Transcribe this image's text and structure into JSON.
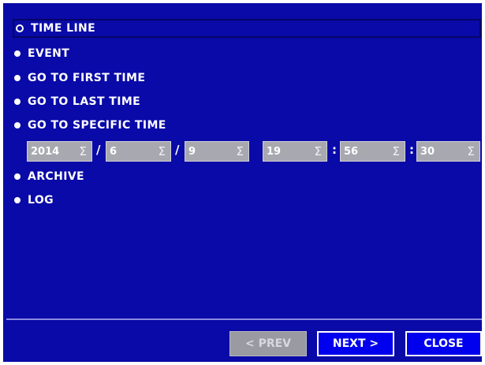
{
  "menu": {
    "items": [
      {
        "label": "TIME LINE",
        "selected": true
      },
      {
        "label": "EVENT"
      },
      {
        "label": "GO TO FIRST TIME"
      },
      {
        "label": "GO TO LAST TIME"
      },
      {
        "label": "GO TO SPECIFIC TIME"
      },
      {
        "label": "ARCHIVE"
      },
      {
        "label": "LOG"
      }
    ]
  },
  "specific_time": {
    "year": "2014",
    "month": "6",
    "day": "9",
    "hour": "19",
    "minute": "56",
    "second": "30",
    "date_separator": "/",
    "time_separator": ":",
    "spinner_glyph": "Σ"
  },
  "footer": {
    "prev_label": "< PREV",
    "next_label": "NEXT >",
    "close_label": "CLOSE"
  },
  "colors": {
    "background": "#0a0aa8",
    "button_active": "#0000ee",
    "button_disabled": "#9a9aa2",
    "field": "#a8a8b0"
  }
}
